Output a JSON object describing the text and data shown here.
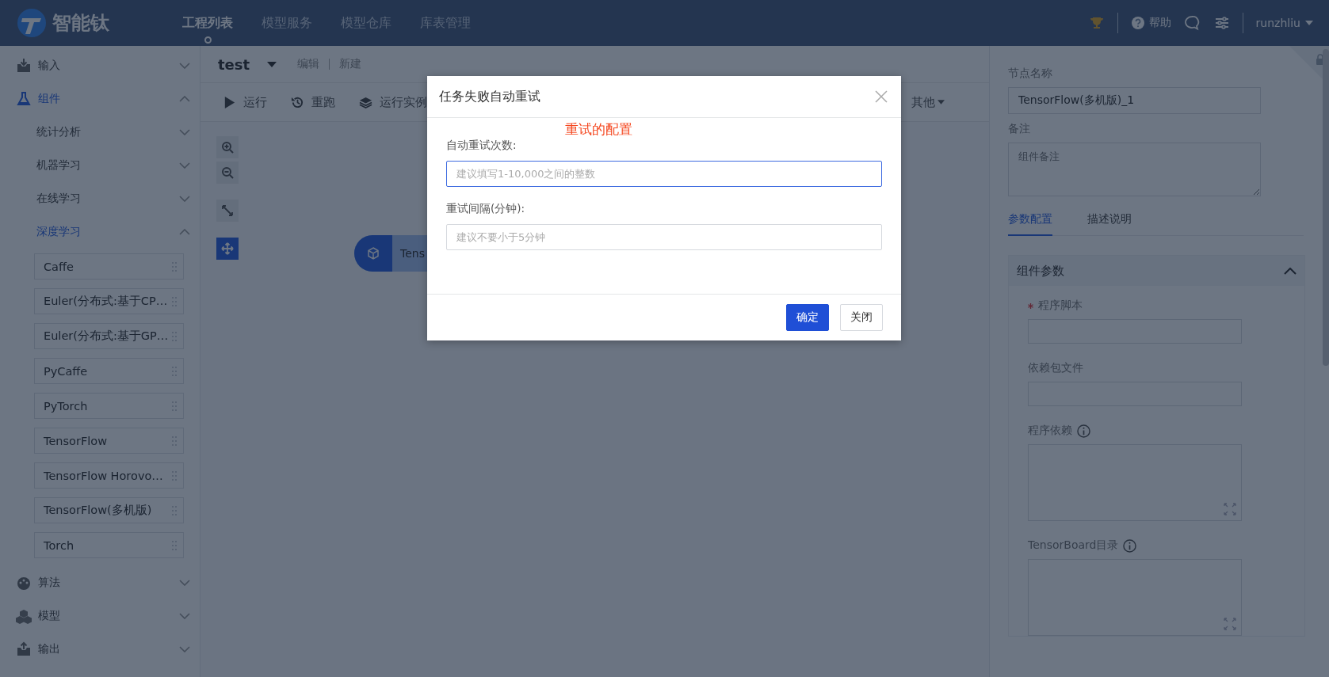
{
  "top_bar": {
    "logo_text": "智能钛",
    "nav": [
      {
        "label": "工程列表",
        "selected": true
      },
      {
        "label": "模型服务",
        "selected": false
      },
      {
        "label": "模型仓库",
        "selected": false
      },
      {
        "label": "库表管理",
        "selected": false
      }
    ],
    "help": "帮助",
    "user": "runzhliu"
  },
  "sidebar": {
    "sections": [
      {
        "label": "输入",
        "expanded": false
      },
      {
        "label": "组件",
        "expanded": true,
        "children": [
          {
            "label": "统计分析",
            "expanded": false
          },
          {
            "label": "机器学习",
            "expanded": false
          },
          {
            "label": "在线学习",
            "expanded": false
          },
          {
            "label": "深度学习",
            "expanded": true,
            "children": [
              {
                "label": "Caffe"
              },
              {
                "label": "Euler(分布式:基于CP…"
              },
              {
                "label": "Euler(分布式:基于GP…"
              },
              {
                "label": "PyCaffe"
              },
              {
                "label": "PyTorch"
              },
              {
                "label": "TensorFlow"
              },
              {
                "label": "TensorFlow Horovo…"
              },
              {
                "label": "TensorFlow(多机版)"
              },
              {
                "label": "Torch"
              }
            ]
          }
        ]
      },
      {
        "label": "算法",
        "expanded": false
      },
      {
        "label": "模型",
        "expanded": false
      },
      {
        "label": "输出",
        "expanded": false
      }
    ]
  },
  "project": {
    "name": "test",
    "actions": [
      "编辑",
      "新建"
    ]
  },
  "toolbar": [
    {
      "label": "运行",
      "kind": "button"
    },
    {
      "label": "重跑",
      "kind": "button"
    },
    {
      "label": "运行实例",
      "kind": "button"
    },
    {
      "label": "其他",
      "kind": "dropdown"
    }
  ],
  "canvas": {
    "tools": [
      {
        "kind": "zoom-in",
        "selected": false
      },
      {
        "kind": "zoom-out",
        "selected": false
      },
      {
        "kind": "fit",
        "selected": false
      },
      {
        "kind": "move",
        "selected": true
      }
    ],
    "node": {
      "label": "Tens"
    }
  },
  "dialog": {
    "title": "任务失败自动重试",
    "note": "重试的配置",
    "fields": [
      {
        "label": "自动重试次数:",
        "placeholder": "建议填写1-10,000之间的整数",
        "focused": true
      },
      {
        "label": "重试间隔(分钟):",
        "placeholder": "建议不要小于5分钟",
        "focused": false
      }
    ],
    "buttons": [
      {
        "label": "确定",
        "kind": "primary"
      },
      {
        "label": "关闭",
        "kind": "default"
      }
    ]
  },
  "right_panel": {
    "node_name_label": "节点名称",
    "node_name": "TensorFlow(多机版)_1",
    "remark_label": "备注",
    "remark_placeholder": "组件备注",
    "tabs": [
      {
        "label": "参数配置",
        "selected": true
      },
      {
        "label": "描述说明",
        "selected": false
      }
    ],
    "section": {
      "title": "组件参数",
      "expanded": true,
      "fields": [
        {
          "label": "程序脚本",
          "required": true,
          "info": false,
          "kind": "input"
        },
        {
          "label": "依赖包文件",
          "required": false,
          "info": false,
          "kind": "input"
        },
        {
          "label": "程序依赖",
          "required": false,
          "info": true,
          "kind": "textarea"
        },
        {
          "label": "TensorBoard目录",
          "required": false,
          "info": true,
          "kind": "textarea"
        }
      ]
    }
  }
}
